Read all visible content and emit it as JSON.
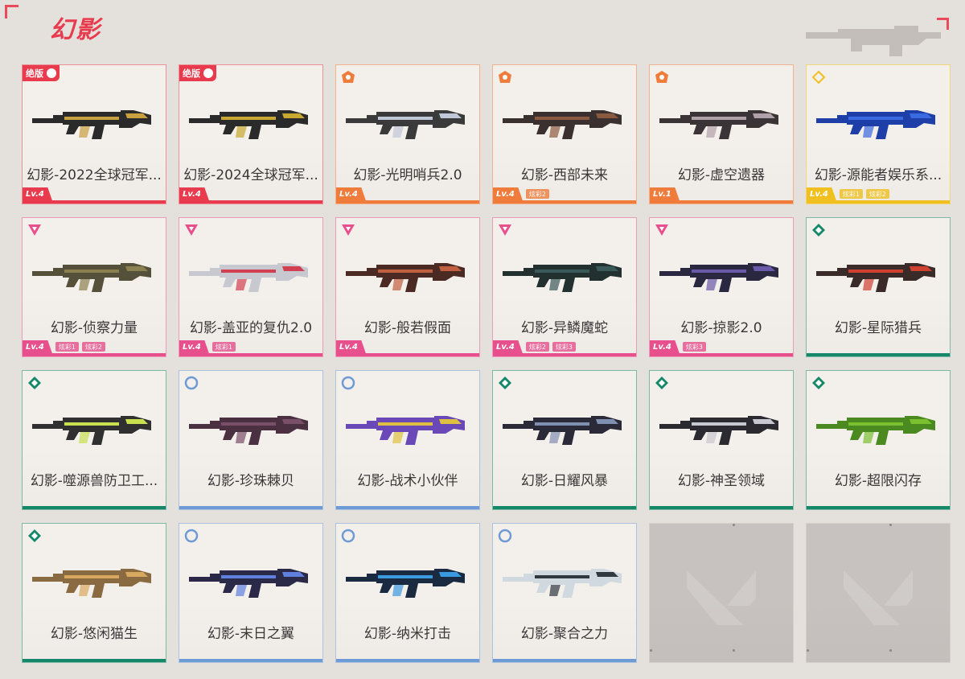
{
  "header": {
    "title": "幻影"
  },
  "colors": {
    "exclusive": "#e83c4e",
    "premium": "#f07c3c",
    "ultra": "#f0c020",
    "select": "#e7508c",
    "deluxe": "#16886a",
    "standard": "#6e9ad6"
  },
  "cards": [
    {
      "name": "幻影-2022全球冠军...",
      "tier": "exclusive",
      "badge": "绝版",
      "level": "Lv.4",
      "variants": [],
      "gun": "#2a2a2a",
      "accent": "#c8a040"
    },
    {
      "name": "幻影-2024全球冠军...",
      "tier": "exclusive",
      "badge": "绝版",
      "level": "Lv.4",
      "variants": [],
      "gun": "#2a2a2a",
      "accent": "#c8a830"
    },
    {
      "name": "幻影-光明哨兵2.0",
      "tier": "premium",
      "badge": "",
      "level": "Lv.4",
      "variants": [],
      "gun": "#3a3a3a",
      "accent": "#c0c8d8"
    },
    {
      "name": "幻影-西部未来",
      "tier": "premium",
      "badge": "",
      "level": "Lv.4",
      "variants": [
        "炫彩2"
      ],
      "gun": "#3a3030",
      "accent": "#8a5a40"
    },
    {
      "name": "幻影-虚空遗器",
      "tier": "premium",
      "badge": "",
      "level": "Lv.1",
      "variants": [],
      "gun": "#3a3436",
      "accent": "#b0a0a8"
    },
    {
      "name": "幻影-源能者娱乐系...",
      "tier": "ultra",
      "badge": "",
      "level": "Lv.4",
      "variants": [
        "炫彩1",
        "炫彩2"
      ],
      "gun": "#1f3fa8",
      "accent": "#3a6ae0"
    },
    {
      "name": "幻影-侦察力量",
      "tier": "select",
      "badge": "",
      "level": "Lv.4",
      "variants": [
        "炫彩1",
        "炫彩2"
      ],
      "gun": "#55503a",
      "accent": "#8a8050"
    },
    {
      "name": "幻影-盖亚的复仇2.0",
      "tier": "select",
      "badge": "",
      "level": "Lv.4",
      "variants": [
        "炫彩1"
      ],
      "gun": "#c8c8d0",
      "accent": "#d04050"
    },
    {
      "name": "幻影-般若假面",
      "tier": "select",
      "badge": "",
      "level": "Lv.4",
      "variants": [],
      "gun": "#4a2a22",
      "accent": "#c06040"
    },
    {
      "name": "幻影-异鳞魔蛇",
      "tier": "select",
      "badge": "",
      "level": "Lv.4",
      "variants": [
        "炫彩2",
        "炫彩3"
      ],
      "gun": "#223030",
      "accent": "#3a5a5a"
    },
    {
      "name": "幻影-掠影2.0",
      "tier": "select",
      "badge": "",
      "level": "Lv.4",
      "variants": [
        "炫彩3"
      ],
      "gun": "#2a2840",
      "accent": "#6a58a8"
    },
    {
      "name": "幻影-星际猎兵",
      "tier": "deluxe",
      "badge": "",
      "level": "",
      "variants": [],
      "gun": "#3a2a28",
      "accent": "#d04030"
    },
    {
      "name": "幻影-噬源兽防卫工...",
      "tier": "deluxe",
      "badge": "",
      "level": "",
      "variants": [],
      "gun": "#303030",
      "accent": "#c8e050"
    },
    {
      "name": "幻影-珍珠棘贝",
      "tier": "standard",
      "badge": "",
      "level": "",
      "variants": [],
      "gun": "#4a3040",
      "accent": "#7a5068"
    },
    {
      "name": "幻影-战术小伙伴",
      "tier": "standard",
      "badge": "",
      "level": "",
      "variants": [],
      "gun": "#6a48b8",
      "accent": "#e0c040"
    },
    {
      "name": "幻影-日耀风暴",
      "tier": "deluxe",
      "badge": "",
      "level": "",
      "variants": [],
      "gun": "#2a2a38",
      "accent": "#8090b0"
    },
    {
      "name": "幻影-神圣领域",
      "tier": "deluxe",
      "badge": "",
      "level": "",
      "variants": [],
      "gun": "#2a2a30",
      "accent": "#c8c8d0"
    },
    {
      "name": "幻影-超限闪存",
      "tier": "deluxe",
      "badge": "",
      "level": "",
      "variants": [],
      "gun": "#4a8a20",
      "accent": "#7ac030"
    },
    {
      "name": "幻影-悠闲猫生",
      "tier": "deluxe",
      "badge": "",
      "level": "",
      "variants": [],
      "gun": "#8a6a40",
      "accent": "#d8a860"
    },
    {
      "name": "幻影-末日之翼",
      "tier": "standard",
      "badge": "",
      "level": "",
      "variants": [],
      "gun": "#2a2a48",
      "accent": "#6080e0"
    },
    {
      "name": "幻影-纳米打击",
      "tier": "standard",
      "badge": "",
      "level": "",
      "variants": [],
      "gun": "#1a2a40",
      "accent": "#3a9ae0"
    },
    {
      "name": "幻影-聚合之力",
      "tier": "standard",
      "badge": "",
      "level": "",
      "variants": [],
      "gun": "#d0d8e0",
      "accent": "#303840"
    }
  ],
  "empty_slots": 2
}
